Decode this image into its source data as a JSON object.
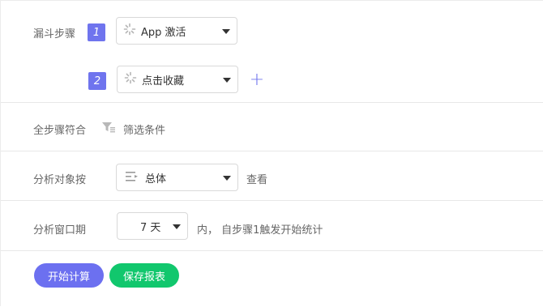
{
  "funnel": {
    "label": "漏斗步骤",
    "steps": [
      {
        "number": "1",
        "event": "App 激活"
      },
      {
        "number": "2",
        "event": "点击收藏"
      }
    ],
    "add_step_symbol": "+"
  },
  "all_steps": {
    "label": "全步骤符合",
    "filter_label": "筛选条件"
  },
  "analysis_object": {
    "label": "分析对象按",
    "selected": "总体",
    "suffix": "查看"
  },
  "window": {
    "label": "分析窗口期",
    "value": "7 天",
    "suffix": "内， 自步骤1触发开始统计"
  },
  "actions": {
    "start_label": "开始计算",
    "save_label": "保存报表"
  },
  "colors": {
    "accent": "#6f74ee",
    "success": "#11c76d"
  }
}
